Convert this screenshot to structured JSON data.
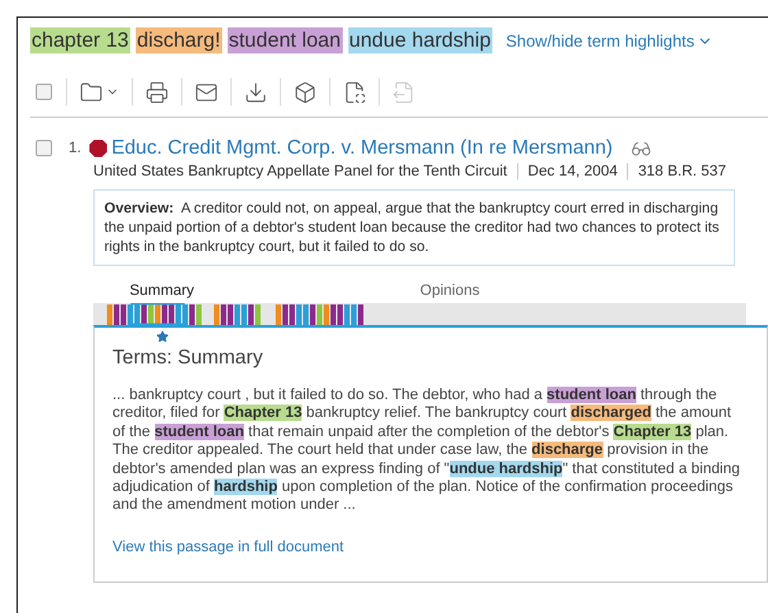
{
  "terms": [
    {
      "text": "chapter 13",
      "color": "#b8dc8e"
    },
    {
      "text": "discharg!",
      "color": "#f5ba7c"
    },
    {
      "text": "student loan",
      "color": "#c9a0d5"
    },
    {
      "text": "undue hardship",
      "color": "#a3d8ee"
    }
  ],
  "highlights_toggle": "Show/hide term highlights",
  "select_all_checked": false,
  "toolbar": [
    {
      "kind": "folder",
      "disabled": false
    },
    {
      "kind": "print",
      "disabled": false
    },
    {
      "kind": "email",
      "disabled": false
    },
    {
      "kind": "download",
      "disabled": false
    },
    {
      "kind": "dropbox",
      "disabled": false
    },
    {
      "kind": "fullview",
      "disabled": false
    },
    {
      "kind": "export",
      "disabled": true
    }
  ],
  "result": {
    "checked": false,
    "number": "1.",
    "title": "Educ. Credit Mgmt. Corp. v. Mersmann (In re Mersmann)",
    "court": "United States Bankruptcy Appellate Panel for the Tenth Circuit",
    "date": "Dec 14, 2004",
    "citation": "318 B.R. 537",
    "overview_label": "Overview:",
    "overview": "A creditor could not, on appeal, argue that the bankruptcy court erred in discharging the unpaid portion of a debtor's student loan because the creditor had two chances to protect its rights in the bankruptcy court, but it failed to do so.",
    "sections": [
      {
        "label": "Summary",
        "selected": true
      },
      {
        "label": "Opinions",
        "selected": false
      }
    ],
    "passage_title": "Terms: Summary",
    "passage": [
      {
        "text": "... bankruptcy court , but it failed to do so. The debtor, who had a "
      },
      {
        "text": "student loan",
        "color": "#c9a0d5"
      },
      {
        "text": " through the creditor, filed for "
      },
      {
        "text": "Chapter 13",
        "color": "#b8dc8e"
      },
      {
        "text": " bankruptcy relief. The bankruptcy court "
      },
      {
        "text": "discharged",
        "color": "#f5ba7c"
      },
      {
        "text": " the amount of the "
      },
      {
        "text": "student loan",
        "color": "#c9a0d5"
      },
      {
        "text": " that remain unpaid after the completion of the debtor's "
      },
      {
        "text": "Chapter 13",
        "color": "#b8dc8e"
      },
      {
        "text": " plan. The creditor appealed. The court held that under case law, the "
      },
      {
        "text": "discharge",
        "color": "#f5ba7c"
      },
      {
        "text": " provision in the debtor's amended plan was an express finding of \""
      },
      {
        "text": "undue hardship",
        "color": "#a3d8ee"
      },
      {
        "text": "\" that constituted a binding adjudication of "
      },
      {
        "text": "hardship",
        "color": "#a3d8ee"
      },
      {
        "text": " upon completion of the plan. Notice of the confirmation proceedings and the amendment motion under ..."
      }
    ],
    "full_document_link": "View this passage in full document"
  }
}
